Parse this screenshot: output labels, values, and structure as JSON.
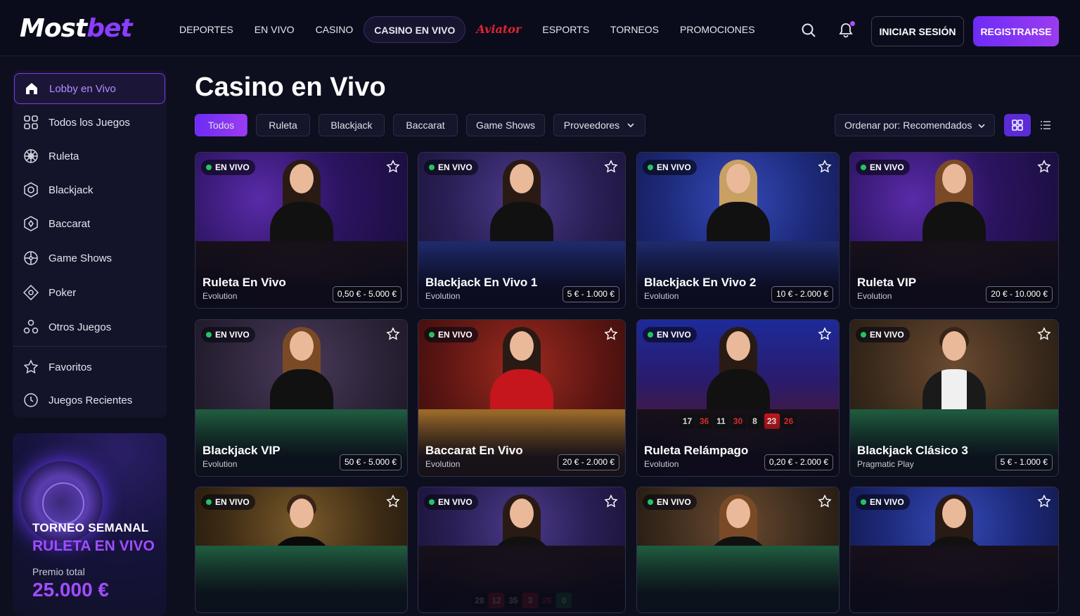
{
  "brand": {
    "logo_a": "Most",
    "logo_b": "bet"
  },
  "nav": [
    "DEPORTES",
    "EN VIVO",
    "CASINO",
    "CASINO EN VIVO",
    "Aviator",
    "ESPORTS",
    "TORNEOS",
    "PROMOCIONES"
  ],
  "nav_active": "CASINO EN VIVO",
  "header": {
    "login": "INICIAR SESIÓN",
    "register": "REGISTRARSE"
  },
  "sidebar": {
    "items": [
      {
        "label": "Lobby en Vivo",
        "icon": "home-icon"
      },
      {
        "label": "Todos los Juegos",
        "icon": "grid-icon"
      },
      {
        "label": "Ruleta",
        "icon": "roulette-icon"
      },
      {
        "label": "Blackjack",
        "icon": "blackjack-icon"
      },
      {
        "label": "Baccarat",
        "icon": "baccarat-icon"
      },
      {
        "label": "Game Shows",
        "icon": "game-shows-icon"
      },
      {
        "label": "Poker",
        "icon": "poker-icon"
      },
      {
        "label": "Otros Juegos",
        "icon": "other-games-icon"
      }
    ],
    "secondary": [
      {
        "label": "Favoritos",
        "icon": "star-icon"
      },
      {
        "label": "Juegos Recientes",
        "icon": "clock-icon"
      }
    ]
  },
  "promo": {
    "line1": "TORNEO SEMANAL",
    "line2": "RULETA EN VIVO",
    "prize_label": "Premio total",
    "prize": "25.000 €"
  },
  "page": {
    "title": "Casino en Vivo"
  },
  "filters": [
    "Todos",
    "Ruleta",
    "Blackjack",
    "Baccarat",
    "Game Shows",
    "Proveedores"
  ],
  "sort": {
    "label": "Ordenar por: Recomendados"
  },
  "live_label": "EN VIVO",
  "games": [
    {
      "title": "Ruleta En Vivo",
      "provider": "Evolution",
      "range": "0,50 € - 5.000 €",
      "theme": "purple",
      "dealer": "dark",
      "table": "roulette"
    },
    {
      "title": "Blackjack En Vivo 1",
      "provider": "Evolution",
      "range": "5 € - 1.000 €",
      "theme": "violet",
      "dealer": "dark",
      "table": "blue"
    },
    {
      "title": "Blackjack En Vivo 2",
      "provider": "Evolution",
      "range": "10 € - 2.000 €",
      "theme": "blue",
      "dealer": "blonde",
      "table": "blue"
    },
    {
      "title": "Ruleta VIP",
      "provider": "Evolution",
      "range": "20 € - 10.000 €",
      "theme": "purple",
      "dealer": "brown",
      "table": "roulette"
    },
    {
      "title": "Blackjack VIP",
      "provider": "Evolution",
      "range": "50 € - 5.000 €",
      "theme": "dim",
      "dealer": "brown",
      "table": "green"
    },
    {
      "title": "Baccarat En Vivo",
      "provider": "Evolution",
      "range": "20 € - 2.000 €",
      "theme": "red",
      "dealer": "dark-red",
      "table": "gold"
    },
    {
      "title": "Ruleta Relámpago",
      "provider": "Evolution",
      "range": "0,20 € - 2.000 €",
      "theme": "neon",
      "dealer": "dark",
      "table": "roulette",
      "numbers": [
        "17",
        "36",
        "11",
        "30",
        "8",
        "23",
        "26"
      ]
    },
    {
      "title": "Blackjack Clásico 3",
      "provider": "Pragmatic Play",
      "range": "5 € - 1.000 €",
      "theme": "wood",
      "dealer": "male",
      "table": "green"
    },
    {
      "title": "",
      "provider": "",
      "range": "",
      "theme": "gold",
      "dealer": "male-black",
      "table": "green"
    },
    {
      "title": "",
      "provider": "",
      "range": "",
      "theme": "violet",
      "dealer": "dark",
      "table": "roulette",
      "numbers": [
        "28",
        "12",
        "35",
        "3",
        "26",
        "0"
      ]
    },
    {
      "title": "",
      "provider": "",
      "range": "",
      "theme": "wood",
      "dealer": "brown",
      "table": "green"
    },
    {
      "title": "",
      "provider": "",
      "range": "",
      "theme": "blue",
      "dealer": "dark",
      "table": "roulette"
    }
  ],
  "colors": {
    "accent": "#7c3aed",
    "live": "#22c55e",
    "bg": "#0d0e1e"
  }
}
